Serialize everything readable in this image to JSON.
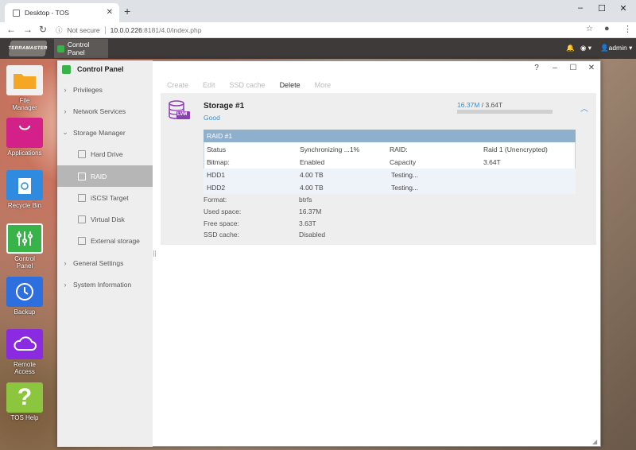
{
  "browser": {
    "tab_title": "Desktop - TOS",
    "security": "Not secure",
    "url_host": "10.0.0.226",
    "url_path": ":8181/4.0/index.php"
  },
  "tos": {
    "logo": "TERRAMASTER",
    "taskbar_app": "Control Panel",
    "user": "admin"
  },
  "desktop_icons": [
    {
      "label": "File Manager",
      "color": "#f0f0f0"
    },
    {
      "label": "Applications",
      "color": "#d4218a"
    },
    {
      "label": "Recycle Bin",
      "color": "#2e8be0"
    },
    {
      "label": "Control Panel",
      "color": "#38b34a"
    },
    {
      "label": "Backup",
      "color": "#2e6fe0"
    },
    {
      "label": "Remote Access",
      "color": "#8a2be2"
    },
    {
      "label": "TOS Help",
      "color": "#8cc63f"
    }
  ],
  "window": {
    "title": "Control Panel",
    "help": "?"
  },
  "sidebar": [
    {
      "label": "Privileges"
    },
    {
      "label": "Network Services"
    },
    {
      "label": "Storage Manager"
    },
    {
      "label": "Hard Drive"
    },
    {
      "label": "RAID"
    },
    {
      "label": "iSCSI Target"
    },
    {
      "label": "Virtual Disk"
    },
    {
      "label": "External storage"
    },
    {
      "label": "General Settings"
    },
    {
      "label": "System Information"
    }
  ],
  "actions": {
    "create": "Create",
    "edit": "Edit",
    "ssd_cache": "SSD cache",
    "delete": "Delete",
    "more": "More"
  },
  "storage": {
    "icon_label": "LVM",
    "name": "Storage #1",
    "status": "Good",
    "used": "16.37M",
    "total": "/ 3.64T",
    "raid_title": "RAID #1",
    "rows": [
      [
        "Status",
        "Synchronizing ...1%",
        "RAID:",
        "Raid 1 (Unencrypted)"
      ],
      [
        "Bitmap:",
        "Enabled",
        "Capacity",
        "3.64T"
      ],
      [
        "HDD1",
        "4.00 TB",
        "Testing...",
        ""
      ],
      [
        "HDD2",
        "4.00 TB",
        "Testing...",
        ""
      ]
    ],
    "info": [
      [
        "Format:",
        "btrfs"
      ],
      [
        "Used space:",
        "16.37M"
      ],
      [
        "Free space:",
        "3.63T"
      ],
      [
        "SSD cache:",
        "Disabled"
      ]
    ]
  }
}
